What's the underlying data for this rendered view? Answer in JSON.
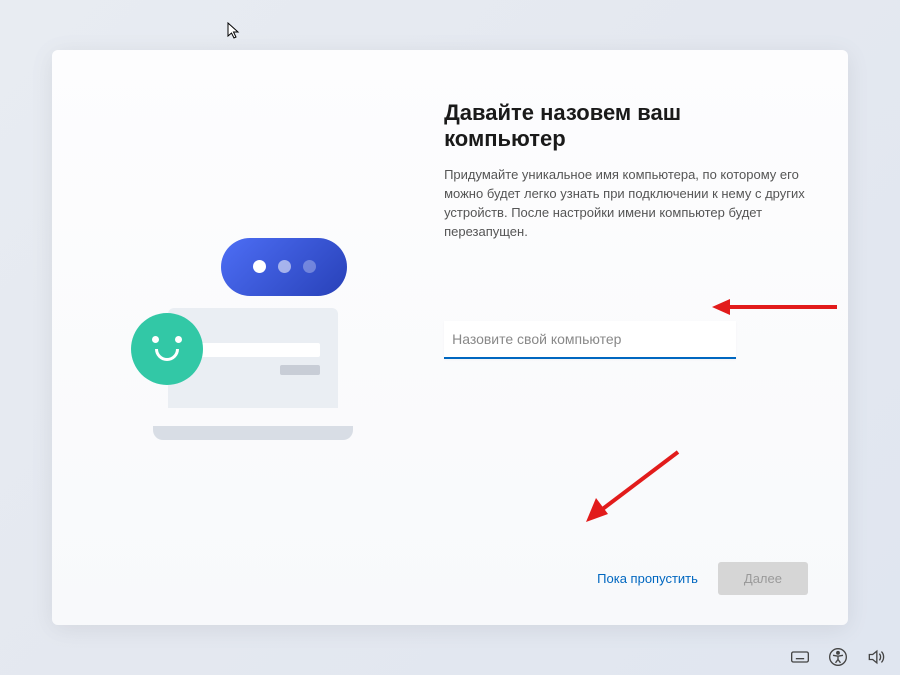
{
  "heading": "Давайте назовем ваш компьютер",
  "description": "Придумайте уникальное имя компьютера, по которому его можно будет легко узнать при подключении к нему с других устройств. После настройки имени компьютер будет перезапущен.",
  "input": {
    "placeholder": "Назовите свой компьютер",
    "value": ""
  },
  "buttons": {
    "skip": "Пока пропустить",
    "next": "Далее"
  }
}
